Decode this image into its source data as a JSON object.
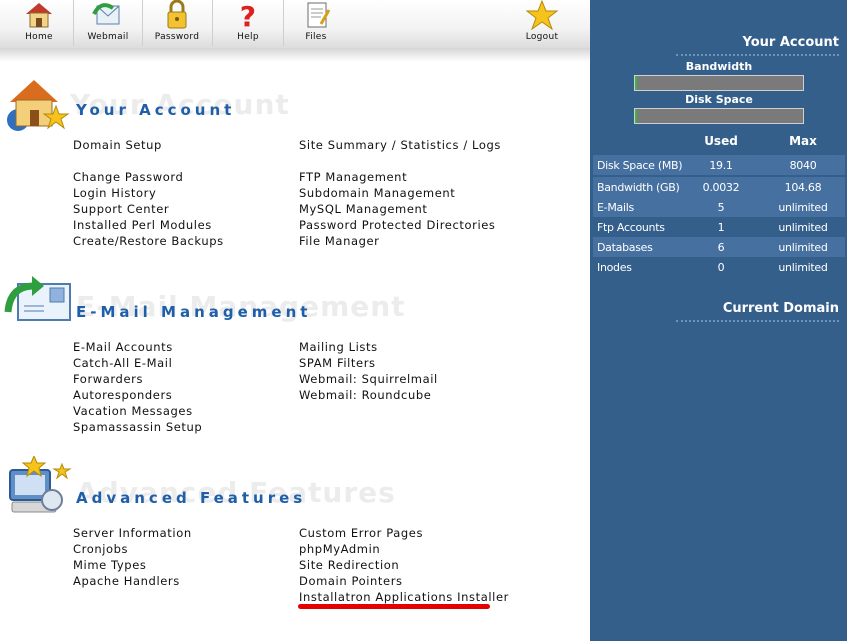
{
  "toolbar": {
    "items": [
      {
        "label": "Home",
        "icon": "home-icon"
      },
      {
        "label": "Webmail",
        "icon": "webmail-icon"
      },
      {
        "label": "Password",
        "icon": "lock-icon"
      },
      {
        "label": "Help",
        "icon": "question-mark-icon"
      },
      {
        "label": "Files",
        "icon": "files-icon"
      },
      {
        "label": "Logout",
        "icon": "star-icon"
      }
    ]
  },
  "sections": {
    "your_account": {
      "title": "Your Account",
      "col1": [
        "Domain Setup",
        "Change Password",
        "Login History",
        "Support Center",
        "Installed Perl Modules",
        "Create/Restore Backups"
      ],
      "col2": [
        "Site Summary / Statistics / Logs",
        "FTP Management",
        "Subdomain Management",
        "MySQL Management",
        "Password Protected Directories",
        "File Manager"
      ]
    },
    "email": {
      "title": "E-Mail Management",
      "col1": [
        "E-Mail Accounts",
        "Catch-All E-Mail",
        "Forwarders",
        "Autoresponders",
        "Vacation Messages",
        "Spamassassin Setup"
      ],
      "col2": [
        "Mailing Lists",
        "SPAM Filters",
        "Webmail: Squirrelmail",
        "Webmail: Roundcube"
      ]
    },
    "advanced": {
      "title": "Advanced Features",
      "col1": [
        "Server Information",
        "Cronjobs",
        "Mime Types",
        "Apache Handlers"
      ],
      "col2": [
        "Custom Error Pages",
        "phpMyAdmin",
        "Site Redirection",
        "Domain Pointers",
        "Installatron Applications Installer"
      ]
    }
  },
  "panel": {
    "heading": "Your Account",
    "bandwidth_label": "Bandwidth",
    "disk_label": "Disk Space",
    "bandwidth_usage_fraction": 0.01,
    "disk_usage_fraction": 0.01,
    "col_used": "Used",
    "col_max": "Max",
    "rows": [
      {
        "label": "Disk Space (MB)",
        "used": "19.1",
        "max": "8040"
      },
      {
        "label": "Bandwidth (GB)",
        "used": "0.0032",
        "max": "104.68"
      },
      {
        "label": "E-Mails",
        "used": "5",
        "max": "unlimited"
      },
      {
        "label": "Ftp Accounts",
        "used": "1",
        "max": "unlimited"
      },
      {
        "label": "Databases",
        "used": "6",
        "max": "unlimited"
      },
      {
        "label": "Inodes",
        "used": "0",
        "max": "unlimited"
      }
    ],
    "current_domain_heading": "Current Domain"
  },
  "colors": {
    "panel_bg": "#345f8b",
    "panel_row_alt": "#4670a0",
    "section_title": "#1f5ea8",
    "highlight_underline": "#e50000"
  }
}
